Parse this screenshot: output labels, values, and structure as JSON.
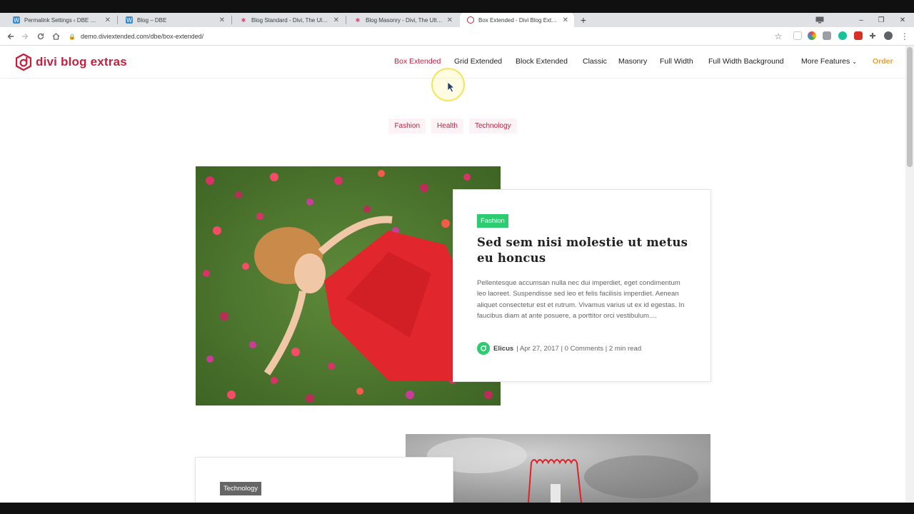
{
  "browser": {
    "tabs": [
      {
        "title": "Permalink Settings ‹ DBE — WordPress",
        "favicon": "wordpress-icon",
        "active": false
      },
      {
        "title": "Blog – DBE",
        "favicon": "wordpress-icon",
        "active": false
      },
      {
        "title": "Blog Standard - Divi, The Ultimate",
        "favicon": "divi-pink-icon",
        "active": false
      },
      {
        "title": "Blog Masonry - Divi, The Ultimate",
        "favicon": "divi-pink-icon",
        "active": false
      },
      {
        "title": "Box Extended - Divi Blog Extras",
        "favicon": "dbe-icon",
        "active": true
      }
    ],
    "new_tab_label": "+",
    "url": "demo.diviextended.com/dbe/box-extended/",
    "window_controls": {
      "minimize": "–",
      "restore": "❐",
      "close": "✕"
    }
  },
  "site": {
    "logo_text": "divi blog extras",
    "brand_color": "#c5203f",
    "nav": [
      {
        "label": "Box Extended",
        "active": true
      },
      {
        "label": "Grid Extended"
      },
      {
        "label": "Block Extended"
      },
      {
        "label": "Classic"
      },
      {
        "label": "Masonry"
      },
      {
        "label": "Full Width"
      },
      {
        "label": "Full Width Background"
      },
      {
        "label": "More Features",
        "has_dropdown": true
      },
      {
        "label": "Order",
        "highlight": true
      }
    ],
    "category_filters": [
      "Fashion",
      "Health",
      "Technology"
    ]
  },
  "posts": [
    {
      "category": "Fashion",
      "category_color": "#2ecc71",
      "title": "Sed sem nisi molestie ut metus eu honcus",
      "excerpt": "Pellentesque accumsan nulla nec dui imperdiet, eget condimentum leo laoreet. Suspendisse sed leo et felis facilisis imperdiet. Aenean aliquet consectetur est et rutrum. Vivamus varius ut ex id egestas. In faucibus diam at ante posuere, a porttitor orci vestibulum....",
      "author": "Elicus",
      "meta": "| Apr 27, 2017 | 0 Comments | 2 min read"
    },
    {
      "category": "Technology",
      "category_color": "#666666"
    }
  ]
}
